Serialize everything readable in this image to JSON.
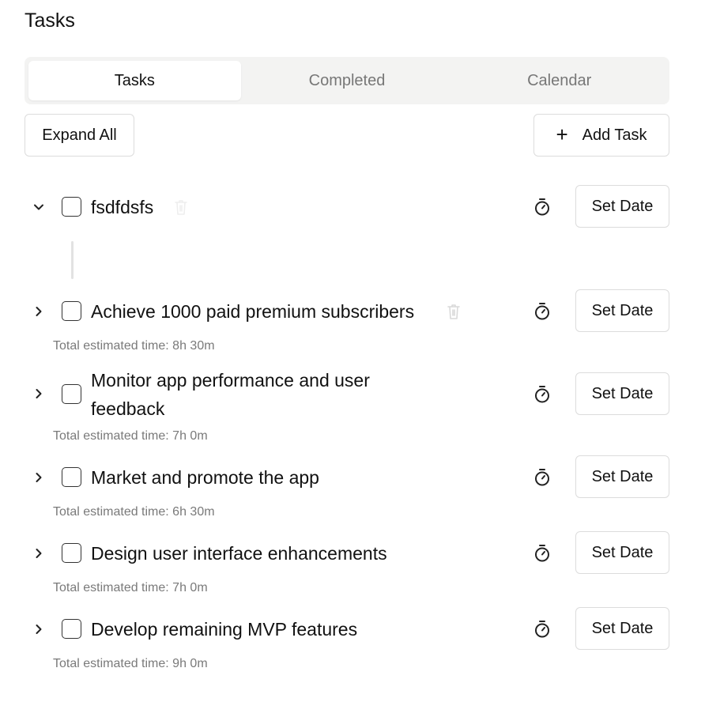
{
  "page_title": "Tasks",
  "tabs": [
    {
      "label": "Tasks",
      "active": true
    },
    {
      "label": "Completed",
      "active": false
    },
    {
      "label": "Calendar",
      "active": false
    }
  ],
  "toolbar": {
    "expand_label": "Expand All",
    "add_label": "Add Task",
    "add_icon": "plus-icon"
  },
  "tasks": [
    {
      "title": "fsdfdsfs",
      "expanded": true,
      "estimate": "",
      "set_date_label": "Set Date"
    },
    {
      "title": "Achieve 1000 paid premium subscribers",
      "expanded": false,
      "estimate": "Total estimated time: 8h 30m",
      "set_date_label": "Set Date"
    },
    {
      "title": "Monitor app performance and user feedback",
      "title_line1": "Monitor app performance and user",
      "title_line2": "feedback",
      "expanded": false,
      "estimate": "Total estimated time: 7h 0m",
      "set_date_label": "Set Date"
    },
    {
      "title": "Market and promote the app",
      "expanded": false,
      "estimate": "Total estimated time: 6h 30m",
      "set_date_label": "Set Date"
    },
    {
      "title": "Design user interface enhancements",
      "expanded": false,
      "estimate": "Total estimated time: 7h 0m",
      "set_date_label": "Set Date"
    },
    {
      "title": "Develop remaining MVP features",
      "expanded": false,
      "estimate": "Total estimated time: 9h 0m",
      "set_date_label": "Set Date"
    }
  ],
  "colors": {
    "tab_bg": "#f3f3f2",
    "border": "#dcdcdc",
    "muted_text": "#7a7a7a",
    "trash_icon": "#d9d9d9"
  }
}
